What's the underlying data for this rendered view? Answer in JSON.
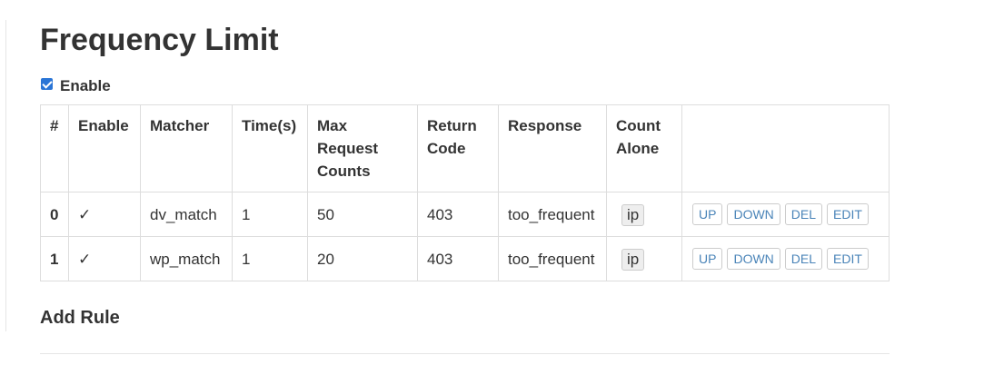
{
  "page": {
    "title": "Frequency Limit",
    "enable_label": "Enable",
    "enabled": true
  },
  "table": {
    "headers": {
      "index": "#",
      "enable": "Enable",
      "matcher": "Matcher",
      "time": "Time(s)",
      "max_count": "Max Request Counts",
      "return_code": "Return Code",
      "response": "Response",
      "count_alone": "Count Alone",
      "actions": ""
    },
    "rows": [
      {
        "index": "0",
        "enable": "✓",
        "matcher": "dv_match",
        "time": "1",
        "max_count": "50",
        "return_code": "403",
        "response": "too_frequent",
        "count_alone": "ip"
      },
      {
        "index": "1",
        "enable": "✓",
        "matcher": "wp_match",
        "time": "1",
        "max_count": "20",
        "return_code": "403",
        "response": "too_frequent",
        "count_alone": "ip"
      }
    ],
    "actions": {
      "up": "UP",
      "down": "DOWN",
      "del": "DEL",
      "edit": "EDIT"
    }
  },
  "add_rule": {
    "title": "Add Rule"
  },
  "colors": {
    "text": "#333333",
    "border": "#dddddd",
    "link_button_text": "#4a84b8",
    "checkbox": "#2a75d6"
  }
}
